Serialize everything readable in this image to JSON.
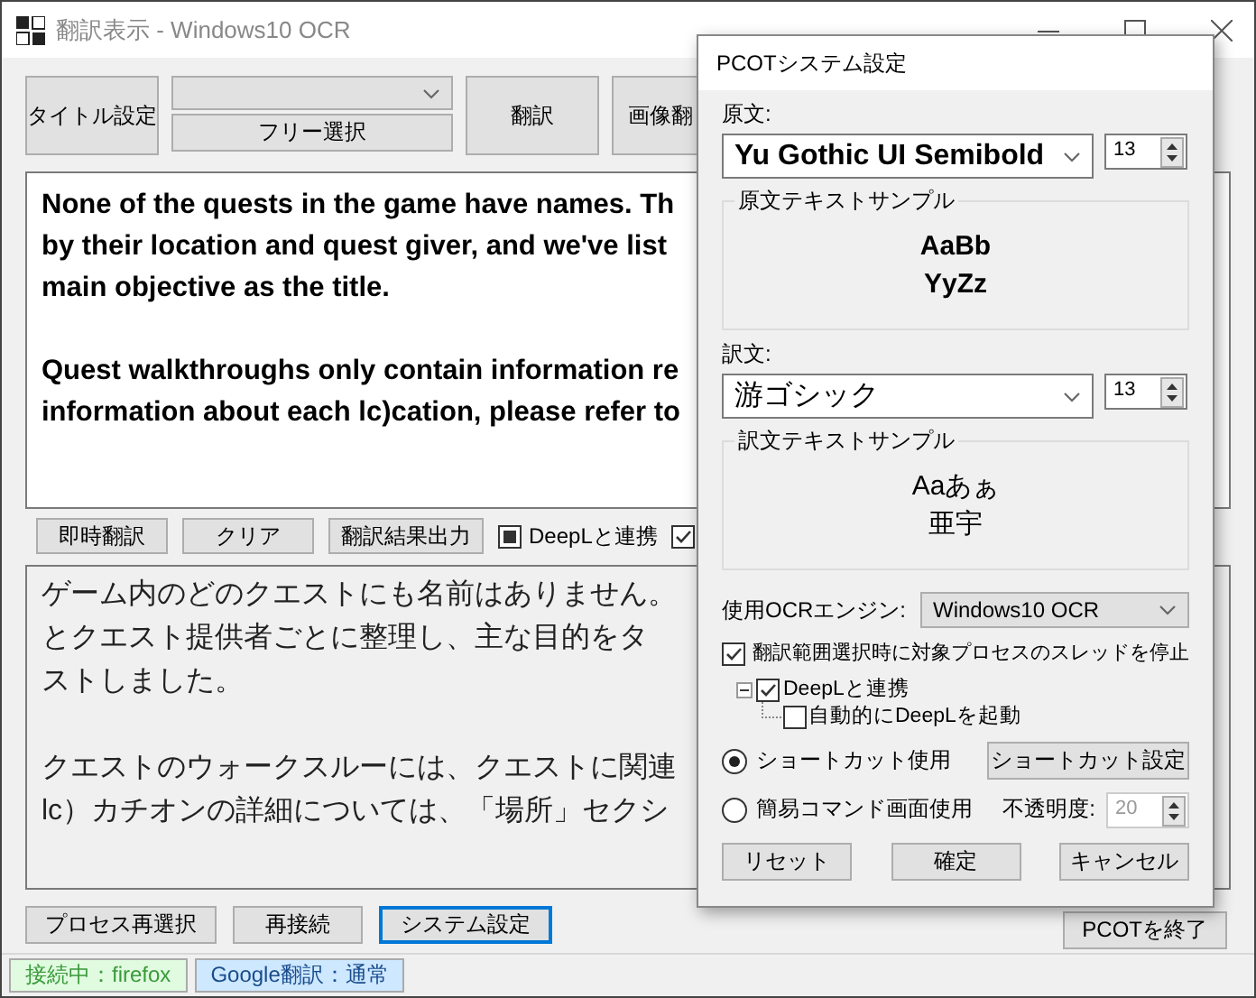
{
  "main_window": {
    "title": "翻訳表示 - Windows10 OCR",
    "toolbar": {
      "title_button": "タイトル設定",
      "free_select_button": "フリー選択",
      "translate_button": "翻訳",
      "image_translate_button": "画像翻"
    },
    "source_text": [
      [
        "None of the quests in the game have names. Th",
        "by their location and quest giver, and we've list",
        "main objective as the title."
      ],
      [
        "Quest walkthroughs only contain information re",
        "information about each lc)cation, please refer to"
      ]
    ],
    "actions": [
      "即時翻訳",
      "クリア",
      "翻訳結果出力"
    ],
    "checkboxes": [
      {
        "label": "DeepLと連携",
        "checked": true,
        "indeterminate": true
      },
      {
        "checked": true,
        "indeterminate": false
      }
    ],
    "translated_text": [
      [
        "ゲーム内のどのクエストにも名前はありません。",
        "とクエスト提供者ごとに整理し、主な目的をタ",
        "ストしました。"
      ],
      [
        "クエストのウォークスルーには、クエストに関連",
        "lc）カチオンの詳細については、「場所」セクシ"
      ]
    ],
    "bottom_buttons": [
      {
        "label": "プロセス再選択",
        "focused": false
      },
      {
        "label": "再接続",
        "focused": false
      },
      {
        "label": "システム設定",
        "focused": true
      }
    ],
    "exit_button": "PCOTを終了",
    "status_bar": [
      {
        "text": "接続中：firefox",
        "color": "#e0fbe0"
      },
      {
        "text": "Google翻訳：通常",
        "color": "#cde8ff"
      }
    ]
  },
  "dialog": {
    "title": "PCOTシステム設定",
    "fonts": [
      {
        "label": "原文:",
        "font": "Yu Gothic UI Semibold",
        "size": "13",
        "sample_title": "原文テキストサンプル",
        "sample_lines": [
          "AaBb",
          "YyZz"
        ],
        "kind": "bold"
      },
      {
        "label": "訳文:",
        "font": "游ゴシック",
        "size": "13",
        "sample_title": "訳文テキストサンプル",
        "sample_lines": [
          "Aaあぁ",
          "亜宇"
        ],
        "kind": "regular"
      }
    ],
    "ocr_engine": {
      "label": "使用OCRエンジン:",
      "value": "Windows10 OCR"
    },
    "pause_thread": {
      "label": "翻訳範囲選択時に対象プロセスのスレッドを停止",
      "checked": true
    },
    "deepl_tree": {
      "label": "DeepLと連携",
      "checked": true,
      "expanded": true,
      "children": [
        {
          "label": "自動的にDeepLを起動",
          "checked": false
        }
      ]
    },
    "modes": [
      {
        "label": "ショートカット使用",
        "selected": true
      },
      {
        "label": "簡易コマンド画面使用",
        "selected": false
      }
    ],
    "shortcut_button": "ショートカット設定",
    "opacity": {
      "label": "不透明度:",
      "value": "20",
      "disabled": true
    },
    "buttons": [
      "リセット",
      "確定",
      "キャンセル"
    ]
  }
}
